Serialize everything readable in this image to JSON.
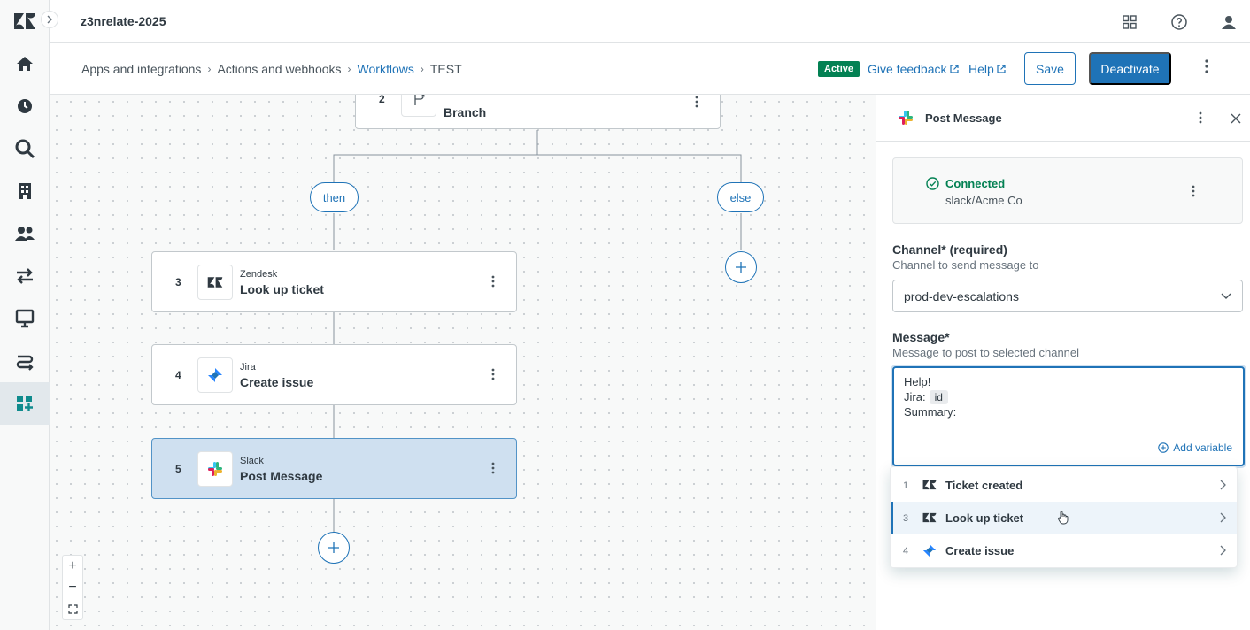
{
  "app": {
    "org_name": "z3nrelate-2025"
  },
  "nav": {
    "items": [
      {
        "name": "home-icon"
      },
      {
        "name": "clock-icon"
      },
      {
        "name": "search-icon"
      },
      {
        "name": "building-icon"
      },
      {
        "name": "users-icon"
      },
      {
        "name": "arrows-icon"
      },
      {
        "name": "monitor-icon"
      },
      {
        "name": "workflow-icon"
      },
      {
        "name": "apps-icon",
        "active": true
      }
    ]
  },
  "breadcrumb": {
    "items": [
      "Apps and integrations",
      "Actions and webhooks",
      "Workflows",
      "TEST"
    ]
  },
  "toolbar": {
    "status_badge": "Active",
    "feedback_label": "Give feedback",
    "help_label": "Help",
    "save_label": "Save",
    "deactivate_label": "Deactivate"
  },
  "workflow": {
    "branch_step": {
      "number": "2",
      "title": "Branch"
    },
    "then_label": "then",
    "else_label": "else",
    "steps": [
      {
        "number": "3",
        "app": "Zendesk",
        "title": "Look up ticket"
      },
      {
        "number": "4",
        "app": "Jira",
        "title": "Create issue"
      },
      {
        "number": "5",
        "app": "Slack",
        "title": "Post Message",
        "selected": true
      }
    ]
  },
  "zoom": {
    "in": "+",
    "out": "−",
    "fit": "⛶"
  },
  "panel": {
    "title": "Post Message",
    "connection": {
      "status": "Connected",
      "account": "slack/Acme Co"
    },
    "channel": {
      "label": "Channel* (required)",
      "hint": "Channel to send message to",
      "value": "prod-dev-escalations"
    },
    "message": {
      "label": "Message*",
      "hint": "Message to post to selected channel",
      "line1": "Help!",
      "line2_prefix": "Jira:",
      "line2_chip": "id",
      "line3": "Summary:",
      "add_variable": "Add variable"
    }
  },
  "variable_dropdown": {
    "items": [
      {
        "number": "1",
        "label": "Ticket created",
        "app": "zendesk"
      },
      {
        "number": "3",
        "label": "Look up ticket",
        "app": "zendesk",
        "hovered": true
      },
      {
        "number": "4",
        "label": "Create issue",
        "app": "jira"
      }
    ]
  },
  "colors": {
    "accent": "#1f73b7",
    "success": "#038153",
    "selected_step": "#cfe0f0"
  }
}
